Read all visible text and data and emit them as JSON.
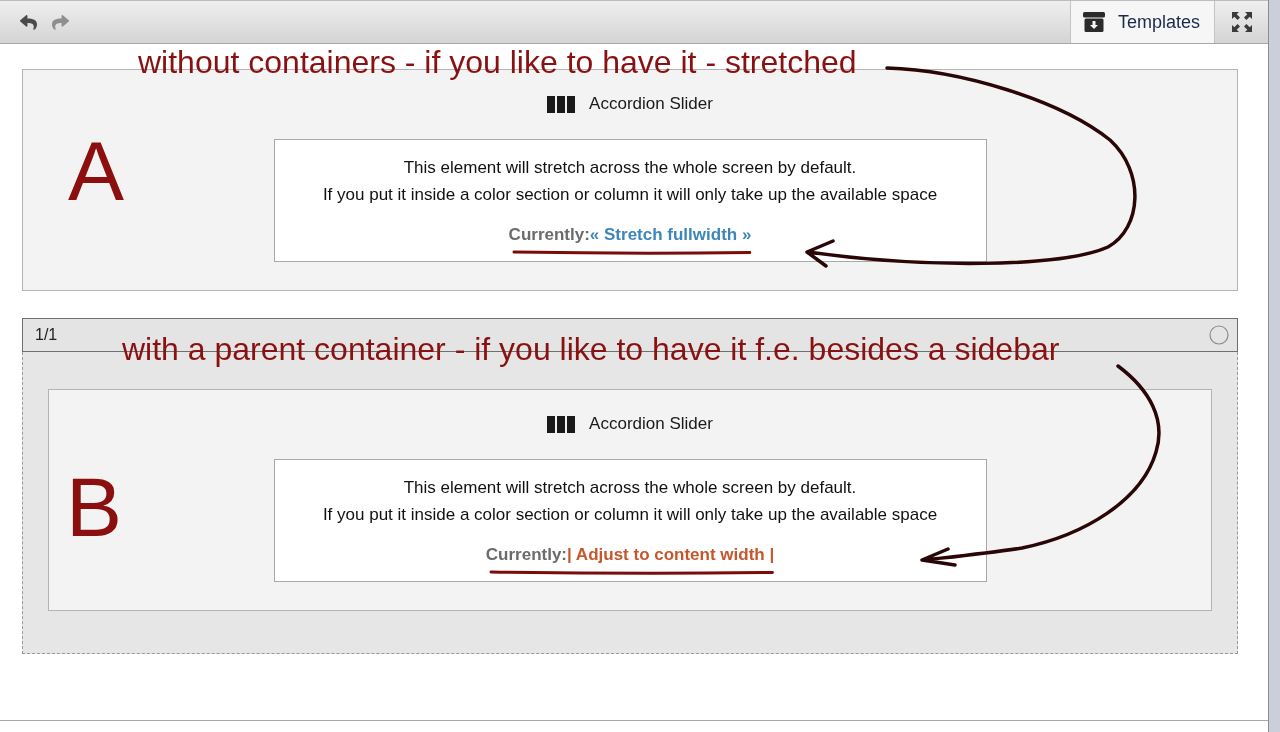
{
  "toolbar": {
    "history_buttons": [
      {
        "kind": "undo",
        "disabled": false
      },
      {
        "kind": "redo",
        "disabled": true
      }
    ],
    "templates_button": {
      "label": "Templates"
    }
  },
  "sections": [
    {
      "kind": "plain",
      "annotation": "without containers - if you like to have it - stretched",
      "letter": "A",
      "element": {
        "kind": "stretch",
        "title": "Accordion Slider",
        "description": [
          "This element will stretch across the whole screen by default.",
          "If you put it inside a color section or column it will only take up the available space"
        ],
        "current_label": "Currently:",
        "current_value": "« Stretch fullwidth »"
      }
    },
    {
      "kind": "container",
      "container_header": "1/1",
      "annotation": "with a parent container - if you like to have it f.e. besides a sidebar",
      "letter": "B",
      "element": {
        "kind": "content",
        "title": "Accordion Slider",
        "description": [
          "This element will stretch across the whole screen by default.",
          "If you put it inside a color section or column it will only take up the available space"
        ],
        "current_label": "Currently:",
        "current_value": "| Adjust to content width |"
      }
    }
  ]
}
